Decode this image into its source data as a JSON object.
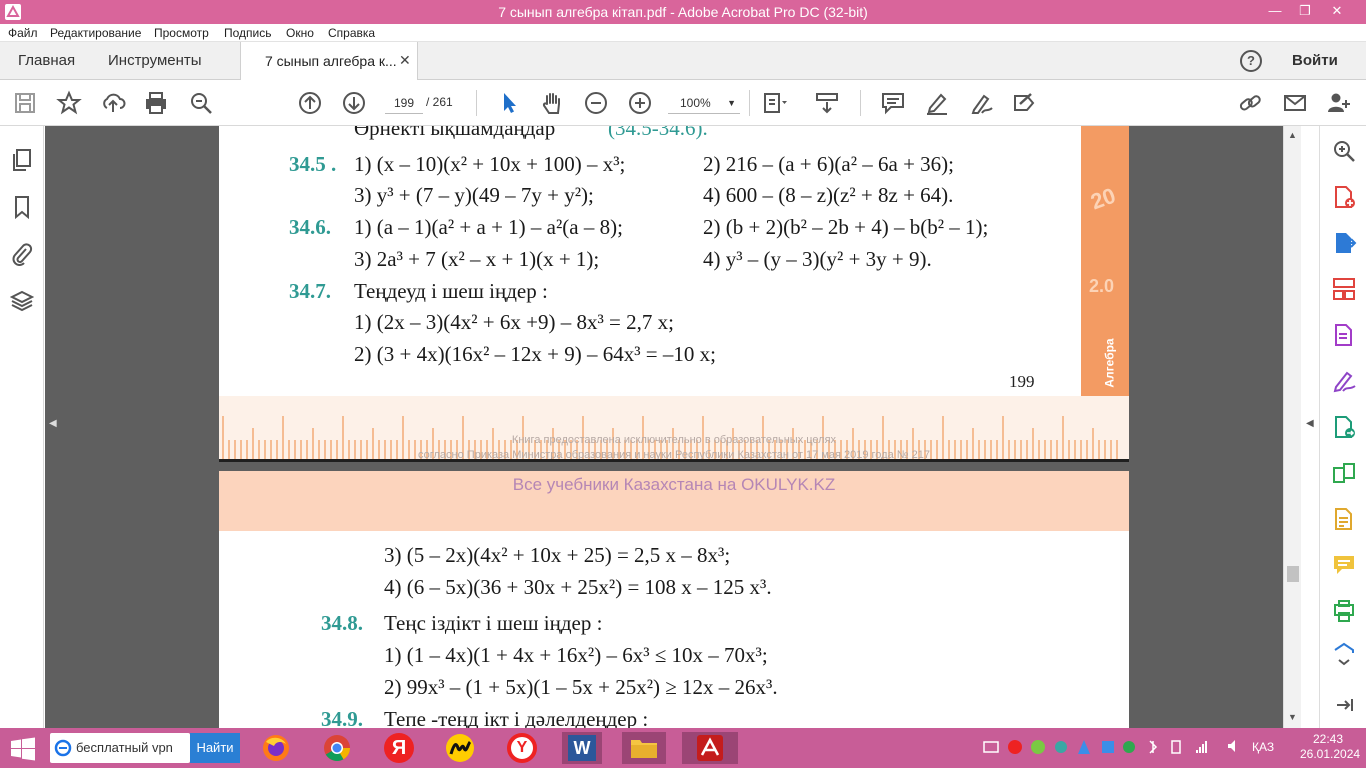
{
  "window": {
    "title": "7 сынып алгебра кітап.pdf - Adobe Acrobat Pro DC (32-bit)",
    "minimize": "—",
    "restore": "❐",
    "close": "✕"
  },
  "menu": [
    "Файл",
    "Редактирование",
    "Просмотр",
    "Подпись",
    "Окно",
    "Справка"
  ],
  "tabs": {
    "home": "Главная",
    "tools": "Инструменты",
    "document": "7 сынып алгебра к...",
    "close": "✕",
    "help": "?",
    "signin": "Войти"
  },
  "toolbar": {
    "current_page": "199",
    "total_pages": "/ 261",
    "zoom": "100%",
    "zoom_caret": "▼",
    "icons": [
      "save-icon",
      "bookmark-star-icon",
      "upload-icon",
      "print-icon",
      "zoom-search-icon",
      "page-up-icon",
      "page-down-icon",
      "select-cursor-icon",
      "hand-icon",
      "zoom-out-icon",
      "zoom-in-icon",
      "crop-pages-icon",
      "scroll-mode-icon",
      "comment-icon",
      "highlight-icon",
      "sign-icon",
      "redact-icon",
      "share-link-icon",
      "email-icon",
      "add-user-icon"
    ]
  },
  "page1": {
    "header_partial": "Өрнекті  ықшамдаңдар",
    "header_range": "(34.5-34.6).",
    "ex_34_5": {
      "num": "34.5 .",
      "l1a": "1) (x – 10)(x² + 10x + 100) – x³;",
      "l1b": "2) 216 – (a + 6)(a² – 6a + 36);",
      "l2a": "3) y³ + (7 – y)(49 – 7y + y²);",
      "l2b": "4) 600 – (8 – z)(z² + 8z + 64)."
    },
    "ex_34_6": {
      "num": "34.6.",
      "l1a": "1) (a – 1)(a² + a + 1) – a²(a – 8);",
      "l1b": "2) (b + 2)(b² – 2b + 4) – b(b² – 1);",
      "l2a": "3) 2a³ + 7 (x² – x + 1)(x + 1);",
      "l2b": "4) y³ – (y – 3)(y² + 3y + 9)."
    },
    "ex_34_7": {
      "num": "34.7.",
      "title": "Теңдеуд  і шеш іңдер :",
      "l1": "1) (2x – 3)(4x² + 6x +9) – 8x³ = 2,7 x;",
      "l2": "2) (3 + 4x)(16x² – 12x + 9) – 64x³ = –10 x;"
    },
    "page_number": "199",
    "strip_text_1": "20",
    "strip_text_2": "2.0",
    "strip_text_3": "Алгебра",
    "watermark_1": "Книга предоставлена исключительно в образовательных целях",
    "watermark_2": "согласно Приказа Министра образования и науки Республики Казахстан от 17 мая 2019 года № 217"
  },
  "page2": {
    "banner": "Все учебники Казахстана на OKULYK.KZ",
    "l1": "3) (5 – 2x)(4x² + 10x + 25) = 2,5 x – 8x³;",
    "l2": "4) (6 – 5x)(36 + 30x + 25x²) = 108 x – 125 x³.",
    "ex_34_8": {
      "num": "34.8.",
      "title": "Теңс іздікт і шеш іңдер :",
      "l1": "1) (1 – 4x)(1 + 4x + 16x²) – 6x³ ≤ 10x – 70x³;",
      "l2": "2) 99x³ – (1 + 5x)(1 – 5x + 25x²) ≥ 12x – 26x³."
    },
    "ex_34_9": {
      "num": "34.9.",
      "title": "Тепе -теңд ікт і дәлелдеңдер  :"
    }
  },
  "taskbar": {
    "search_text": "бесплатный vpn",
    "search_button": "Найти",
    "apps": [
      "firefox-icon",
      "chrome-icon",
      "yandex-icon",
      "yandex-music-icon",
      "yandex-browser-icon",
      "word-icon",
      "file-explorer-icon",
      "acrobat-icon"
    ],
    "word_letter": "W",
    "yandex_letter": "Я",
    "yabrowser_letter": "Y",
    "language": "ҚАЗ",
    "time": "22:43",
    "date": "26.01.2024"
  }
}
